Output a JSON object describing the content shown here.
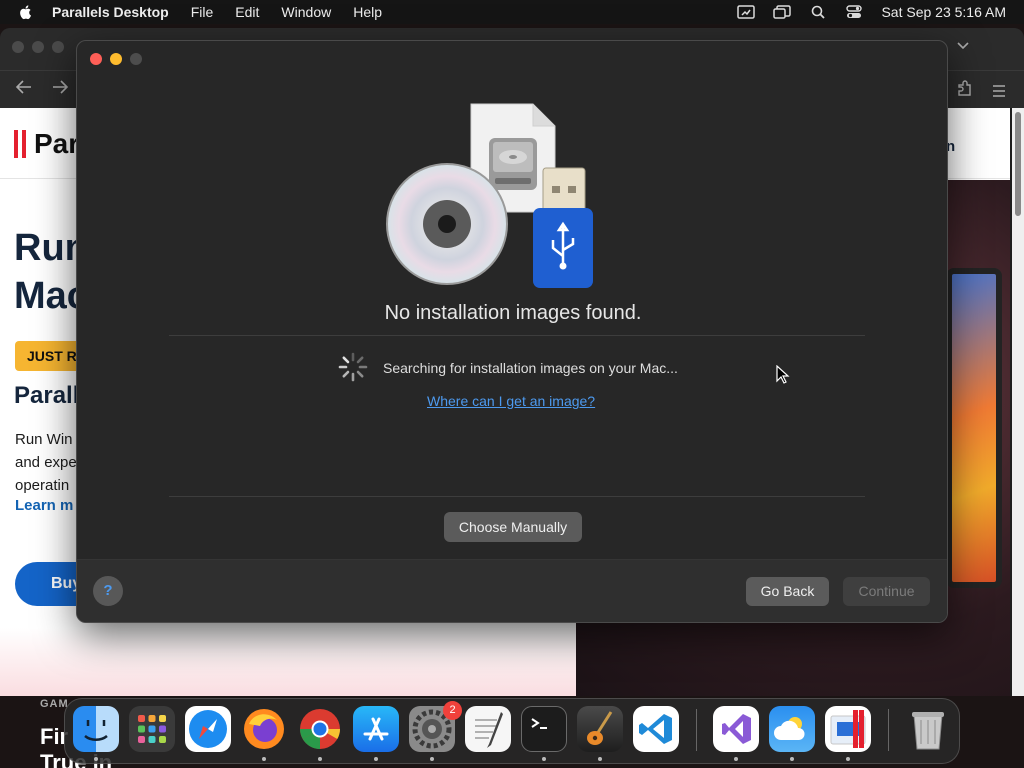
{
  "menubar": {
    "app_name": "Parallels Desktop",
    "menus": [
      "File",
      "Edit",
      "Window",
      "Help"
    ],
    "clock": "Sat Sep 23  5:16 AM",
    "status_icons": [
      "screen-mirroring-icon",
      "stage-manager-icon",
      "spotlight-icon",
      "control-center-icon"
    ]
  },
  "browser_page": {
    "logo_text": "Par",
    "hero_title_line1": "Run",
    "hero_title_line2": "Mac",
    "badge": "JUST R",
    "sub_title": "Parall",
    "body_lines": [
      "Run Win",
      "and expe",
      "operatin"
    ],
    "learn_more": "Learn m",
    "buy_button": "Buy",
    "promo_header_text": "n",
    "below_label": "GAM",
    "below_title_line1": "Fir",
    "below_title_line2": "True in"
  },
  "dialog": {
    "message": "No installation images found.",
    "searching": "Searching for installation images on your Mac...",
    "help_link": "Where can I get an image?",
    "choose_manually": "Choose Manually",
    "help_button": "?",
    "go_back": "Go Back",
    "continue": "Continue",
    "continue_enabled": false
  },
  "dock": {
    "items": [
      "finder",
      "launchpad",
      "safari",
      "firefox",
      "chrome",
      "app-store",
      "system-settings",
      "textedit",
      "terminal",
      "garageband",
      "vscode",
      "visual-studio",
      "weather",
      "parallels-desktop",
      "trash"
    ],
    "system_settings_badge": "2"
  },
  "colors": {
    "dialog_bg": "#272727",
    "link": "#4d9aef",
    "close": "#fe5f57",
    "minimize": "#febc2e"
  }
}
